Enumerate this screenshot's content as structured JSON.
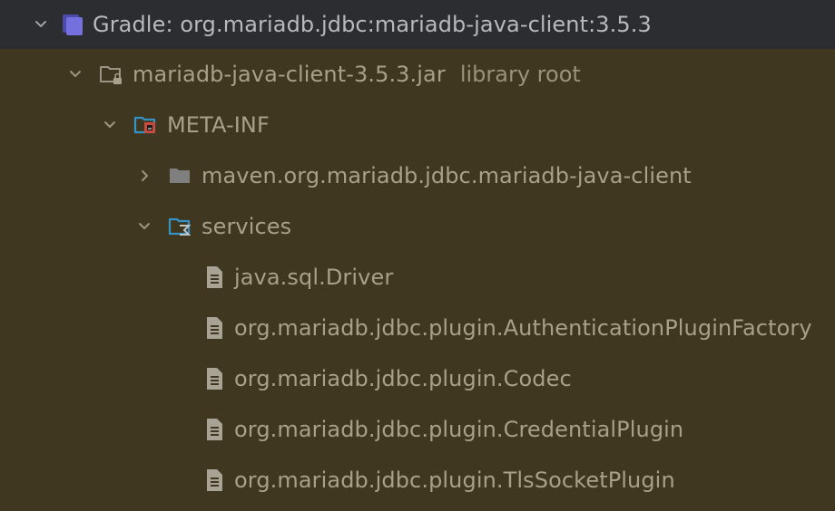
{
  "tree": {
    "gradle_dependency": {
      "label": "Gradle: org.mariadb.jdbc:mariadb-java-client:3.5.3",
      "icon": "gradle-library-icon",
      "expanded": true
    },
    "jar": {
      "label": "mariadb-java-client-3.5.3.jar",
      "secondary": "library root",
      "icon": "locked-folder-icon",
      "expanded": true
    },
    "meta_inf": {
      "label": "META-INF",
      "icon": "meta-inf-folder-icon",
      "expanded": true
    },
    "maven_folder": {
      "label": "maven.org.mariadb.jdbc.mariadb-java-client",
      "icon": "folder-icon",
      "expanded": false
    },
    "services": {
      "label": "services",
      "icon": "services-folder-icon",
      "expanded": true
    },
    "files": [
      {
        "label": "java.sql.Driver",
        "icon": "text-file-icon"
      },
      {
        "label": "org.mariadb.jdbc.plugin.AuthenticationPluginFactory",
        "icon": "text-file-icon"
      },
      {
        "label": "org.mariadb.jdbc.plugin.Codec",
        "icon": "text-file-icon"
      },
      {
        "label": "org.mariadb.jdbc.plugin.CredentialPlugin",
        "icon": "text-file-icon"
      },
      {
        "label": "org.mariadb.jdbc.plugin.TlsSocketPlugin",
        "icon": "text-file-icon"
      }
    ]
  },
  "colors": {
    "top_row_background": "#2b2d30",
    "tree_background": "#403720",
    "text": "#a9a08a",
    "gradle_icon": "#6f6bd6",
    "folder_icon": "#7f7f80",
    "services_icon": "#3592c4"
  }
}
